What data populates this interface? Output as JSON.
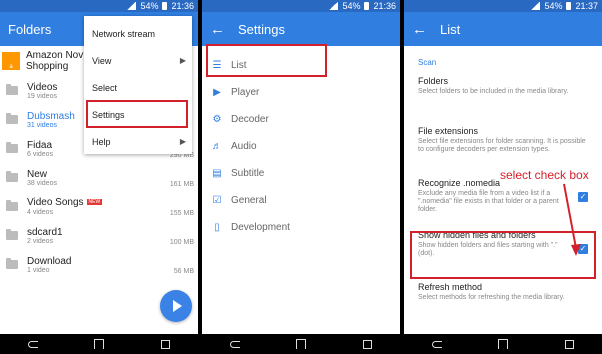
{
  "status": {
    "battery": "54%",
    "time1": "21:36",
    "time2": "21:36",
    "time3": "21:37"
  },
  "panel1": {
    "title": "Folders",
    "ad": {
      "title": "Amazon Nov",
      "subtitle": "Shopping",
      "logo": "amazon"
    },
    "folders": [
      {
        "name": "Videos",
        "count": "19 videos",
        "size": ""
      },
      {
        "name": "Dubsmash",
        "count": "31 videos",
        "size": ""
      },
      {
        "name": "Fidaa",
        "count": "6 videos",
        "size": "290 MB"
      },
      {
        "name": "New",
        "count": "38 videos",
        "size": "161 MB"
      },
      {
        "name": "Video Songs",
        "count": "4 videos",
        "size": "155 MB",
        "badge": "NEW"
      },
      {
        "name": "sdcard1",
        "count": "2 videos",
        "size": "100 MB"
      },
      {
        "name": "Download",
        "count": "1 video",
        "size": "56 MB"
      }
    ],
    "menu": [
      "Network stream",
      "View",
      "Select",
      "Settings",
      "Help"
    ],
    "accent": "#2f7ee0",
    "highlight": "#d3212b"
  },
  "panel2": {
    "title": "Settings",
    "items": [
      {
        "label": "List",
        "icon": "list-icon"
      },
      {
        "label": "Player",
        "icon": "play-icon"
      },
      {
        "label": "Decoder",
        "icon": "gear-icon"
      },
      {
        "label": "Audio",
        "icon": "audio-icon"
      },
      {
        "label": "Subtitle",
        "icon": "subtitle-icon"
      },
      {
        "label": "General",
        "icon": "check-icon"
      },
      {
        "label": "Development",
        "icon": "phone-icon"
      }
    ]
  },
  "panel3": {
    "title": "List",
    "category": "Scan",
    "prefs": [
      {
        "title": "Folders",
        "summary": "Select folders to be included in the media library."
      },
      {
        "title": "File extensions",
        "summary": "Select file extensions for folder scanning. It is possible to configure decoders per extension types."
      },
      {
        "title": "Recognize .nomedia",
        "summary": "Exclude any media file from a video list if a \".nomedia\" file exists in that folder or a parent folder."
      },
      {
        "title": "Show hidden files and folders",
        "summary": "Show hidden folders and files starting with \".\" (dot)."
      },
      {
        "title": "Refresh method",
        "summary": "Select methods for refreshing the media library."
      }
    ],
    "annotation": "select check box"
  }
}
